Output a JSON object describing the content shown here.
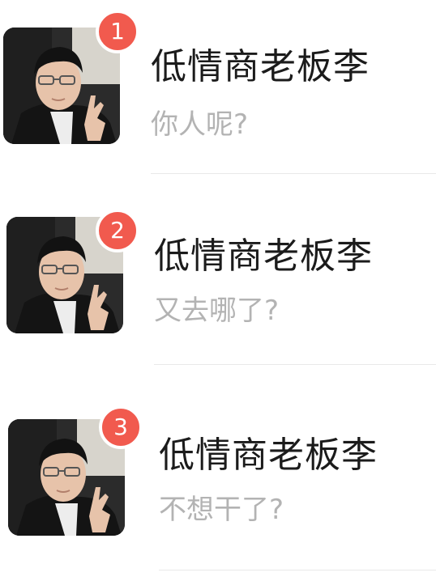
{
  "chats": [
    {
      "badge": "1",
      "name": "低情商老板李",
      "message": "你人呢?"
    },
    {
      "badge": "2",
      "name": "低情商老板李",
      "message": "又去哪了?"
    },
    {
      "badge": "3",
      "name": "低情商老板李",
      "message": "不想干了?"
    }
  ],
  "colors": {
    "badge": "#f15a4e",
    "name": "#1b1b1b",
    "message": "#b3b3b3",
    "divider": "#e9e9e9"
  }
}
